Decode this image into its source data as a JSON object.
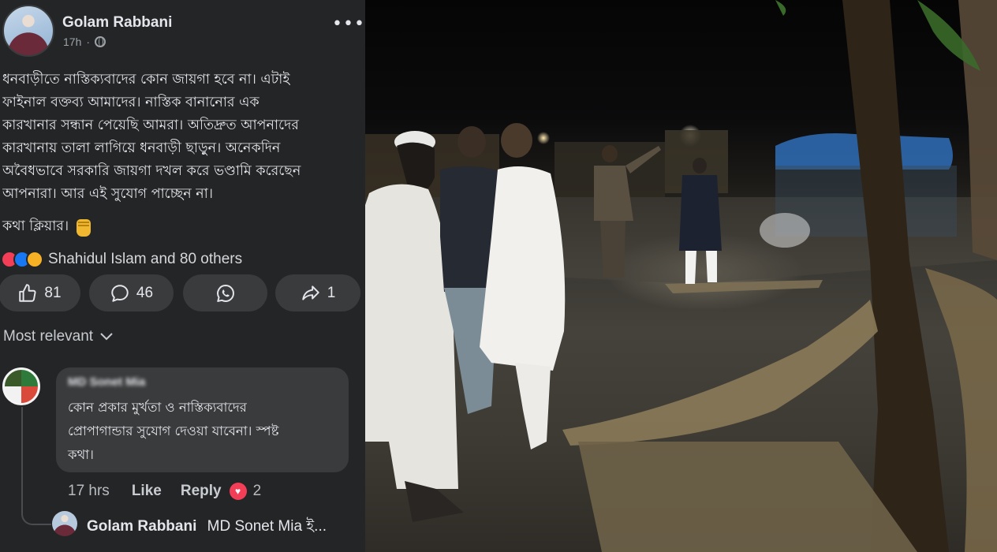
{
  "post": {
    "author": "Golam Rabbani",
    "time": "17h",
    "more_icon": "more-options-icon",
    "body_lines": [
      "ধনবাড়ীতে নাস্তিক্যবাদের কোন জায়গা হবে না। এটাই",
      "ফাইনাল বক্তব্য আমাদের। নাস্তিক বানানোর এক",
      "কারখানার সন্ধান পেয়েছি আমরা। অতিদ্রুত আপনাদের",
      "কারখানায় তালা লাগিয়ে ধনবাড়ী ছাড়ুন। অনেকদিন",
      "অবৈধভাবে সরকারি জায়গা দখল করে ভণ্ডামি করেছেন",
      "আপনারা। আর এই সুযোগ পাচ্ছেন না।"
    ],
    "closing": "কথা ক্লিয়ার।",
    "reactions_text": "Shahidul Islam and 80 others"
  },
  "actions": {
    "like_count": "81",
    "comment_count": "46",
    "share_count": "1"
  },
  "comments": {
    "sort_label": "Most relevant",
    "top": {
      "author": "MD Sonet Mia",
      "lines": [
        "কোন প্রকার মুর্খতা ও নাস্তিক্যবাদের",
        "প্রোপাগান্ডার সুযোগ দেওয়া যাবেনা। স্পষ্ট",
        "কথা।"
      ],
      "time": "17 hrs",
      "like_label": "Like",
      "reply_label": "Reply",
      "reaction_count": "2"
    },
    "reply": {
      "author": "Golam Rabbani",
      "preview": "MD Sonet Mia ই..."
    }
  },
  "colors": {
    "panel_bg": "#242526",
    "bubble_bg": "#3a3b3c",
    "love": "#f33e58",
    "like": "#1877f2",
    "text": "#e4e6eb"
  }
}
